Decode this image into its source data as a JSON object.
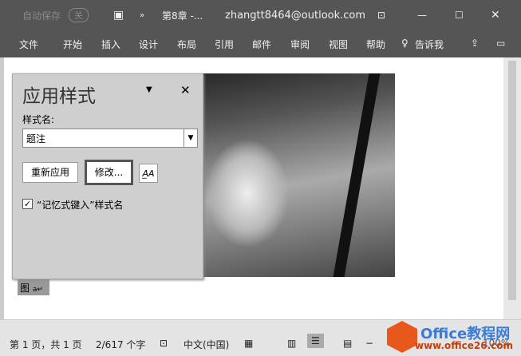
{
  "titlebar": {
    "autosave": "自动保存",
    "autosave_state": "关",
    "doc_title": "第8章 -...",
    "account": "zhangtt8464@outlook.com"
  },
  "menu": [
    "文件",
    "开始",
    "插入",
    "设计",
    "布局",
    "引用",
    "邮件",
    "审阅",
    "视图",
    "帮助",
    "告诉我"
  ],
  "panel": {
    "title": "应用样式",
    "style_name_label": "样式名:",
    "style_value": "题注",
    "reapply": "重新应用",
    "modify": "修改...",
    "autocomplete_label": "“记忆式键入”样式名",
    "autocomplete_checked": true
  },
  "doc": {
    "caption": "图"
  },
  "status": {
    "page": "第 1 页，共 1 页",
    "words": "2/617 个字",
    "language": "中文(中国)",
    "zoom": "100%"
  },
  "watermark": {
    "brand": "Office教程网",
    "url": "www.office26.com"
  }
}
